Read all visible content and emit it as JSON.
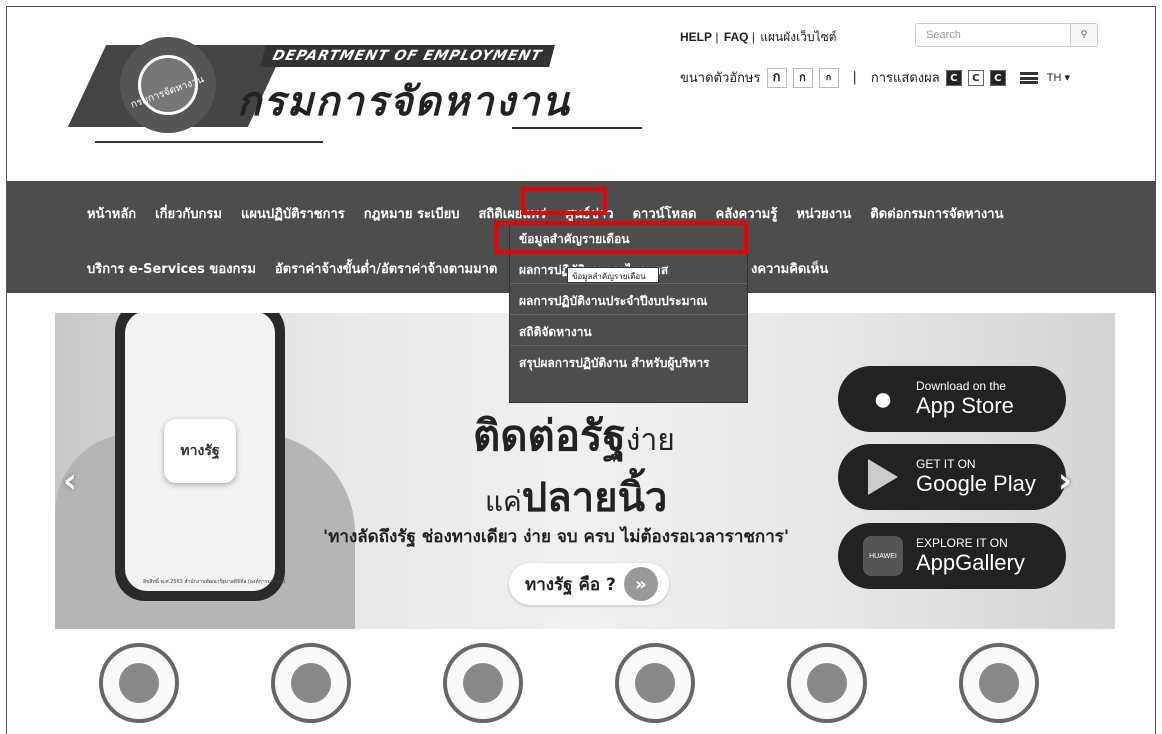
{
  "header": {
    "seal_text": "กรมการจัดหางาน",
    "dept_en": "DEPARTMENT OF EMPLOYMENT",
    "dept_th": "กรมการจัดหางาน",
    "toplinks": [
      "HELP",
      "FAQ",
      "แผนผังเว็บไซต์"
    ],
    "search_placeholder": "Search",
    "search_icon": "search-icon",
    "fontsize_label": "ขนาดตัวอักษร",
    "font_buttons": [
      "ก",
      "ก",
      "ก"
    ],
    "display_label": "การแสดงผล",
    "contrast_buttons": [
      "C",
      "C",
      "C"
    ],
    "lang": "TH ▾"
  },
  "nav": {
    "row1": [
      "หน้าหลัก",
      "เกี่ยวกับกรม",
      "แผนปฏิบัติราชการ",
      "กฎหมาย ระเบียบ",
      "สถิติเผยแพร่",
      "ศูนย์ข่าว",
      "ดาวน์โหลด",
      "คลังความรู้",
      "หน่วยงาน",
      "ติดต่อกรมการจัดหางาน"
    ],
    "row2": [
      "บริการ e-Services ของกรม",
      "อัตราค่าจ้างขั้นต่ำ/อัตราค่าจ้างตามมาต",
      "งความคิดเห็น"
    ]
  },
  "dropdown": {
    "items": [
      "ข้อมูลสำคัญรายเดือน",
      "ผลการปฏิบัติงานรายไตรมาส",
      "ผลการปฏิบัติงานประจำปีงบประมาณ",
      "สถิติจัดหางาน",
      "สรุปผลการปฏิบัติงาน สำหรับผู้บริหาร"
    ],
    "tooltip": "ข้อมูลสำคัญรายเดือน"
  },
  "banner": {
    "app_name": "ทางรัฐ",
    "headline1": "ติดต่อรัฐ",
    "headline1_small": "ง่าย",
    "headline2_small": "แค่",
    "headline2": "ปลายนิ้ว",
    "quote": "'ทางลัดถึงรัฐ ช่องทางเดียว ง่าย จบ ครบ ไม่ต้องรอเวลาราชการ'",
    "cta": "ทางรัฐ คือ ?",
    "caption": "ลิขสิทธิ์ พ.ศ.2563 สำนักงานพัฒนารัฐบาลดิจิทัล (องค์การมหาชน)",
    "stores": [
      {
        "small": "Download on the",
        "big": "App Store"
      },
      {
        "small": "GET IT ON",
        "big": "Google Play"
      },
      {
        "small": "EXPLORE IT ON",
        "big": "AppGallery"
      }
    ]
  }
}
